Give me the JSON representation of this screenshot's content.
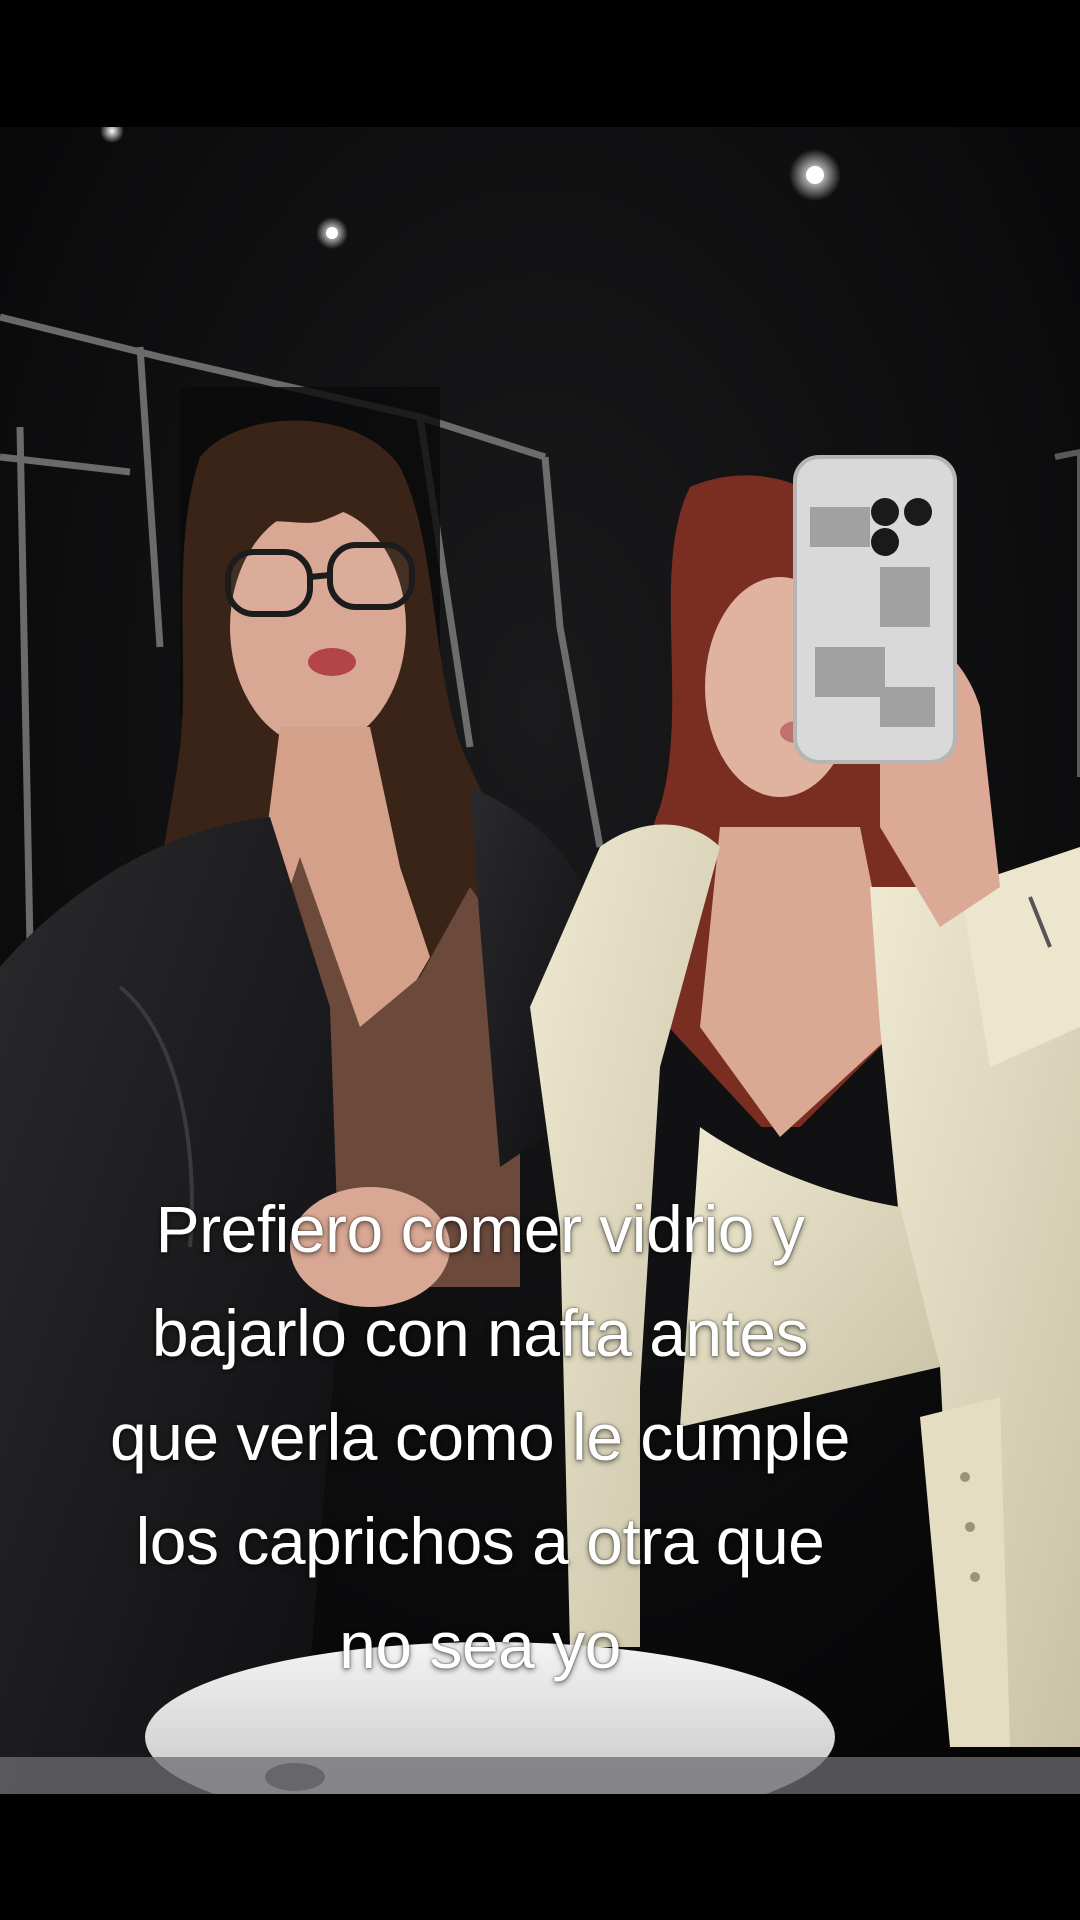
{
  "caption": {
    "lines": [
      "Prefiero comer vidrio y",
      "bajarlo con nafta antes",
      "que verla como le cumple",
      "los caprichos a otra que",
      "no sea yo"
    ]
  },
  "colors": {
    "background": "#000000",
    "caption_text": "#ffffff",
    "cream_jacket": "#e8e2c8",
    "black_jacket": "#1a1a1c",
    "brown_top": "#6b4a3c",
    "dark_hair": "#3a2418",
    "red_hair": "#7a2e22"
  }
}
